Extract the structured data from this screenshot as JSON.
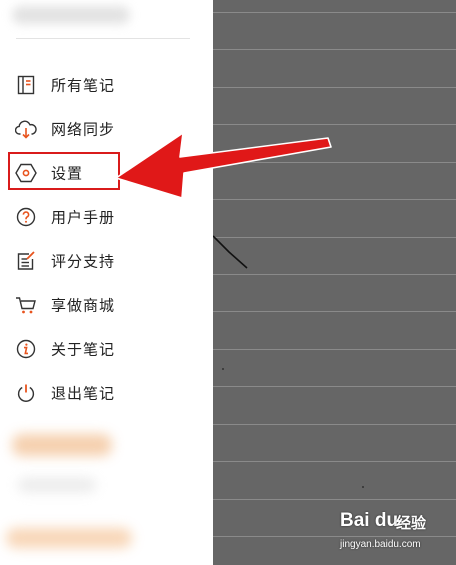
{
  "drawer": {
    "menu": [
      {
        "label": "所有笔记",
        "icon": "notebook-icon"
      },
      {
        "label": "网络同步",
        "icon": "cloud-sync-icon"
      },
      {
        "label": "设置",
        "icon": "settings-hexagon-icon",
        "highlighted": true
      },
      {
        "label": "用户手册",
        "icon": "help-circle-icon"
      },
      {
        "label": "评分支持",
        "icon": "rate-edit-icon"
      },
      {
        "label": "享做商城",
        "icon": "shopping-cart-icon"
      },
      {
        "label": "关于笔记",
        "icon": "info-circle-icon"
      },
      {
        "label": "退出笔记",
        "icon": "power-icon"
      }
    ]
  },
  "colors": {
    "accent": "#e8541e",
    "highlight_border": "#d91b1b",
    "arrow": "#e01818",
    "content_background": "#666666"
  },
  "watermark": {
    "brand": "Bai du",
    "cn": "经验",
    "url": "jingyan.baidu.com"
  }
}
